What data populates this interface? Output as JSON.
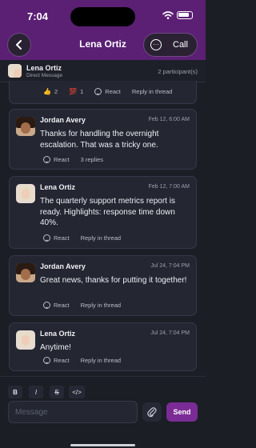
{
  "status": {
    "time": "7:04"
  },
  "nav": {
    "title": "Lena Ortiz",
    "call_label": "Call"
  },
  "conversation": {
    "name": "Lena Ortiz",
    "subtitle": "Direct Message",
    "participants": "2 participant(s)"
  },
  "partial_message": {
    "reactions": [
      {
        "emoji": "👍",
        "count": "2"
      },
      {
        "emoji": "💯",
        "count": "1"
      }
    ],
    "react_label": "React",
    "reply_label": "Reply in thread"
  },
  "messages": [
    {
      "author": "Jordan Avery",
      "time": "Feb 12, 6:00 AM",
      "text": "Thanks for handling the overnight escalation. That was a tricky one.",
      "react_label": "React",
      "reply_label": "3 replies"
    },
    {
      "author": "Lena Ortiz",
      "time": "Feb 12, 7:00 AM",
      "text": "The quarterly support metrics report is ready. Highlights: response time down 40%.",
      "react_label": "React",
      "reply_label": "Reply in thread"
    },
    {
      "author": "Jordan Avery",
      "time": "Jul 24, 7:04 PM",
      "text": "Great news, thanks for putting it together!",
      "react_label": "React",
      "reply_label": "Reply in thread"
    },
    {
      "author": "Lena Ortiz",
      "time": "Jul 24, 7:04 PM",
      "text": "Anytime!",
      "react_label": "React",
      "reply_label": "Reply in thread"
    }
  ],
  "composer": {
    "bold": "B",
    "italic": "I",
    "strike": "S",
    "code": "</>",
    "placeholder": "Message",
    "send_label": "Send"
  },
  "colors": {
    "header": "#5b1f74",
    "accent": "#7b2b95",
    "background": "#1c1e26",
    "card": "#242732"
  },
  "icons": {
    "back": "chevron-left-icon",
    "call": "more-circle-icon",
    "attach": "paperclip-icon",
    "react": "smile-icon"
  }
}
